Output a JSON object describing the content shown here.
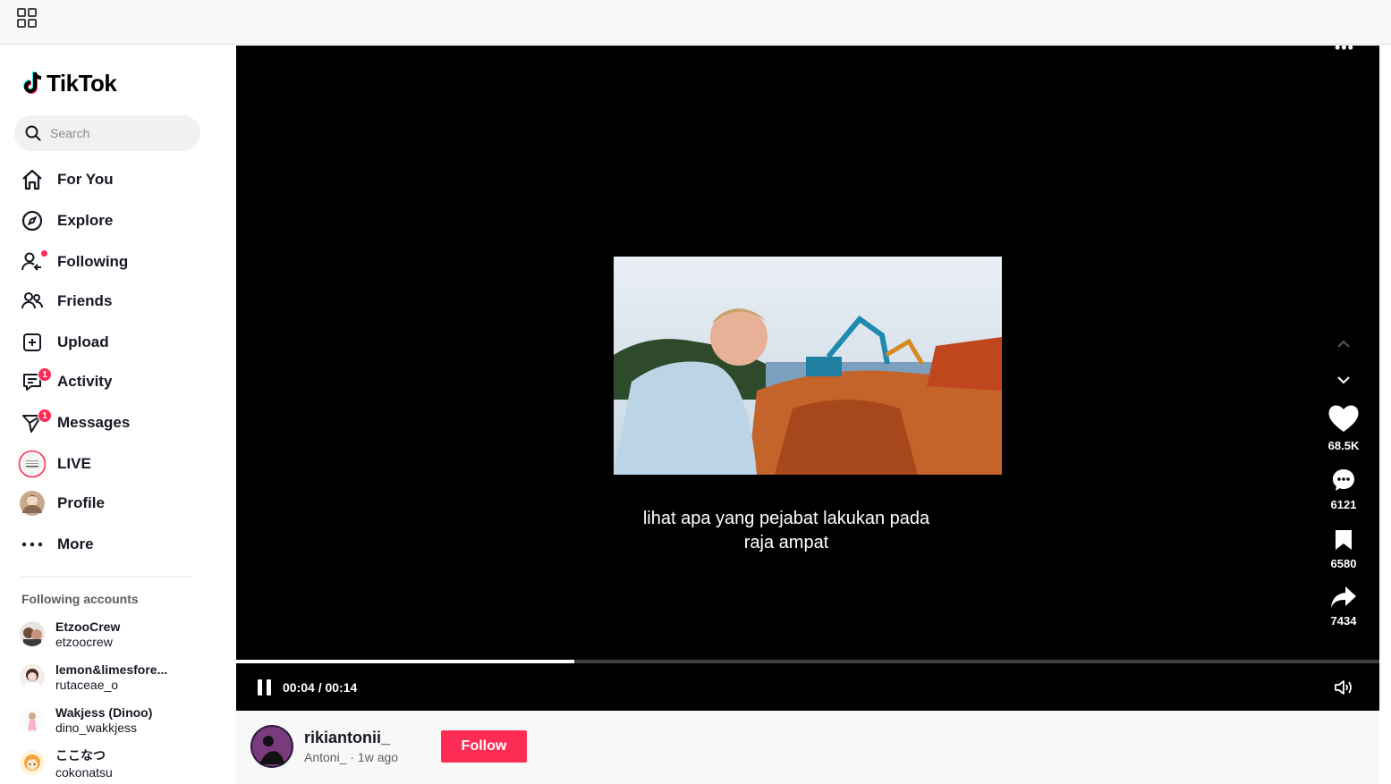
{
  "app": {
    "name": "TikTok"
  },
  "search": {
    "placeholder": "Search"
  },
  "nav": [
    {
      "id": "for-you",
      "label": "For You",
      "icon": "home-icon"
    },
    {
      "id": "explore",
      "label": "Explore",
      "icon": "compass-icon"
    },
    {
      "id": "following",
      "label": "Following",
      "icon": "following-icon"
    },
    {
      "id": "friends",
      "label": "Friends",
      "icon": "friends-icon"
    },
    {
      "id": "upload",
      "label": "Upload",
      "icon": "upload-icon"
    },
    {
      "id": "activity",
      "label": "Activity",
      "icon": "activity-icon",
      "badge": "1"
    },
    {
      "id": "messages",
      "label": "Messages",
      "icon": "messages-icon",
      "badge": "1"
    },
    {
      "id": "live",
      "label": "LIVE",
      "icon": "live-icon"
    },
    {
      "id": "profile",
      "label": "Profile",
      "icon": "profile-avatar"
    },
    {
      "id": "more",
      "label": "More",
      "icon": "more-icon"
    }
  ],
  "following_accounts": {
    "title": "Following accounts",
    "items": [
      {
        "name": "EtzooCrew",
        "handle": "etzoocrew"
      },
      {
        "name": "lemon&limesfore...",
        "handle": "rutaceae_o"
      },
      {
        "name": "Wakjess (Dinoo)",
        "handle": "dino_wakkjess"
      },
      {
        "name": "ここなつ",
        "handle": "cokonatsu"
      }
    ]
  },
  "video": {
    "caption_line1": "lihat apa yang pejabat lakukan pada",
    "caption_line2": "raja ampat",
    "progress": 0.296,
    "time": "00:04 / 00:14",
    "actions": {
      "likes": "68.5K",
      "comments": "6121",
      "saves": "6580",
      "shares": "7434"
    }
  },
  "author": {
    "username": "rikiantonii_",
    "meta": "Antoni_ · 1w ago",
    "follow_label": "Follow"
  },
  "colors": {
    "accent": "#fe2c55",
    "player_bg": "#000000",
    "text": "#161823"
  }
}
